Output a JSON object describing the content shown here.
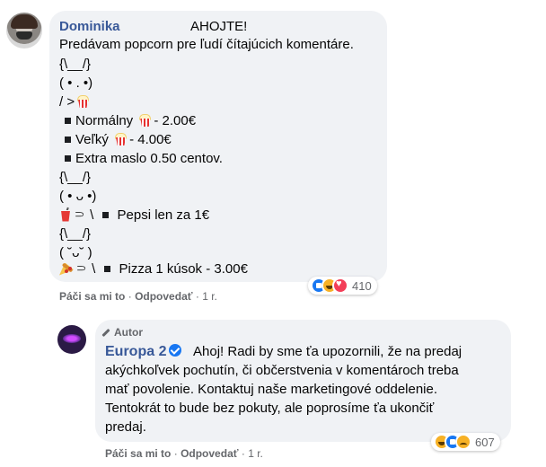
{
  "comment": {
    "author": "Dominika",
    "greeting": "AHOJTE!",
    "intro": "Predávam popcorn pre ľudí čítajúcich komentáre.",
    "art1": [
      "{\\__/}",
      "( • . •)",
      "/ >"
    ],
    "items": [
      {
        "label": "Normálny",
        "price": "- 2.00€",
        "icon": "popcorn-icon"
      },
      {
        "label": "Veľký",
        "price": "- 4.00€",
        "icon": "popcorn-icon"
      },
      {
        "label": "Extra maslo 0.50 centov.",
        "price": "",
        "icon": ""
      }
    ],
    "art2": [
      "{\\__/}",
      "( • ᴗ •)"
    ],
    "drink_hand": "⸧ \\",
    "drink": "Pepsi len za 1€",
    "art3": [
      "{\\__/}",
      "( ˘ᴗ˘ )"
    ],
    "pizza_hand": "⸧ \\",
    "pizza": "Pizza 1 kúsok - 3.00€",
    "actions": {
      "like": "Páči sa mi to",
      "sep": "·",
      "reply": "Odpovedať",
      "time": "1 r."
    },
    "reactions": {
      "icons": [
        "like",
        "haha",
        "love"
      ],
      "count": "410"
    }
  },
  "reply": {
    "badge": "Autor",
    "author": "Europa 2",
    "lines": [
      "Ahoj! Radi by sme ťa upozornili, že na predaj",
      "akýchkoľvek pochutín, či občerstvenia v komentároch treba",
      "mať povolenie. Kontaktuj naše marketingové oddelenie.",
      "Tentokrát to bude bez pokuty, ale poprosíme ťa ukončiť",
      "predaj."
    ],
    "actions": {
      "like": "Páči sa mi to",
      "sep": "·",
      "reply": "Odpovedať",
      "time": "1 r."
    },
    "reactions": {
      "icons": [
        "haha",
        "like",
        "sad"
      ],
      "count": "607"
    }
  },
  "colors": {
    "bubble": "#f0f2f5",
    "link": "#385898",
    "meta": "#65676b"
  }
}
